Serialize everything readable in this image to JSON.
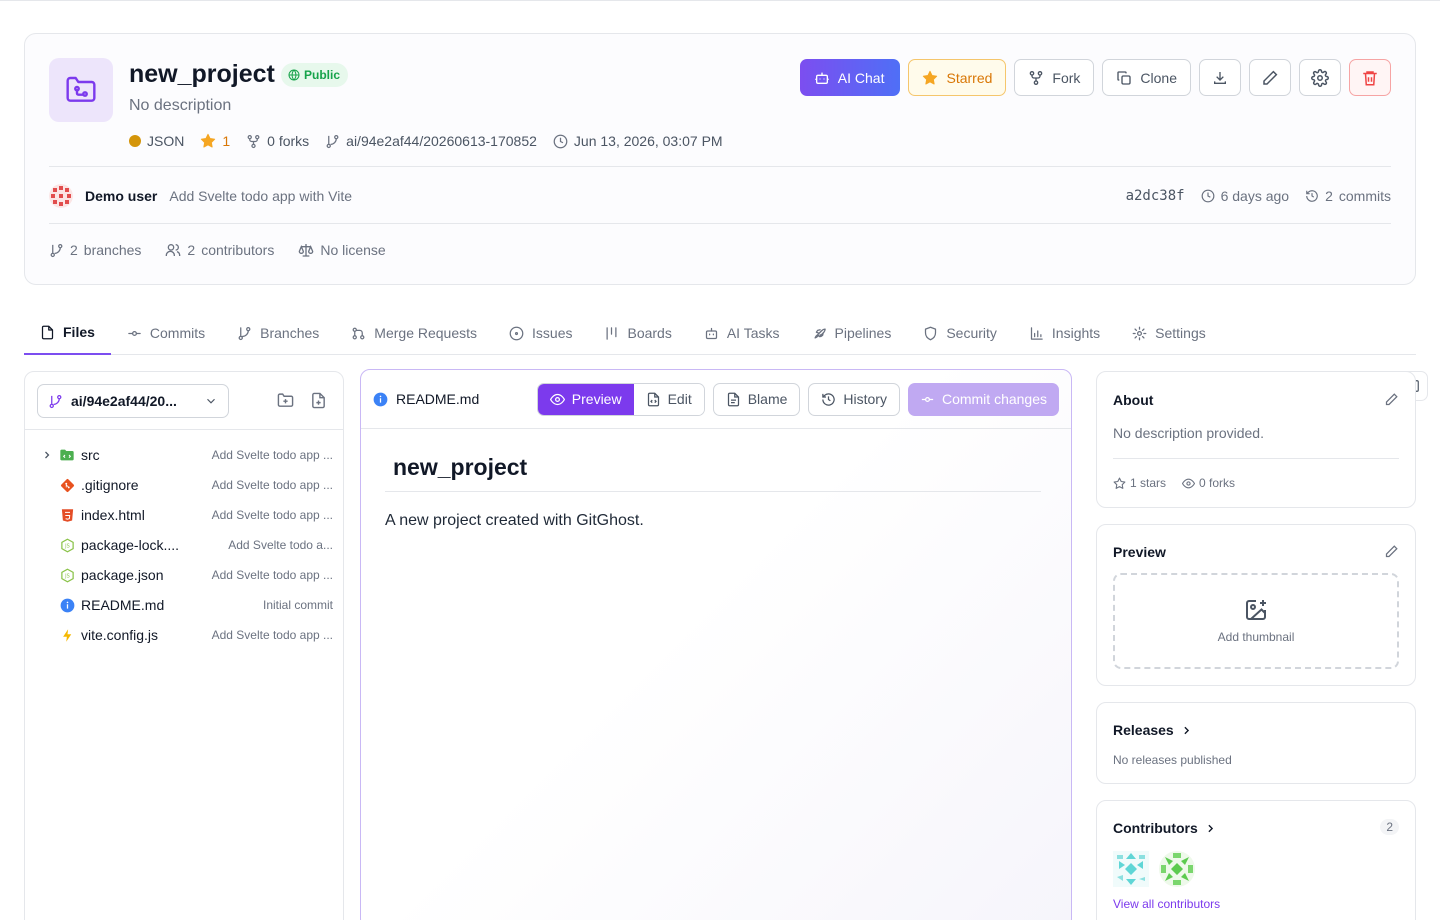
{
  "repo": {
    "name": "new_project",
    "visibility": "Public",
    "description": "No description",
    "language": "JSON",
    "language_color": "#d4950a",
    "stars": "1",
    "forks": "0 forks",
    "branch_ref": "ai/94e2af44/20260613-170852",
    "updated": "Jun 13, 2026, 03:07 PM"
  },
  "actions": {
    "ai_chat": "AI Chat",
    "starred": "Starred",
    "fork": "Fork",
    "clone": "Clone",
    "download_icon": "download-icon",
    "edit_icon": "pencil-icon",
    "settings_icon": "gear-icon",
    "delete_icon": "trash-icon"
  },
  "last_commit": {
    "author": "Demo user",
    "message": "Add Svelte todo app with Vite",
    "hash": "a2dc38f",
    "time": "6 days ago",
    "commits_count": "2",
    "commits_label": "commits"
  },
  "stats": {
    "branches_count": "2",
    "branches_label": "branches",
    "contributors_count": "2",
    "contributors_label": "contributors",
    "license": "No license"
  },
  "tabs": [
    {
      "label": "Files",
      "icon": "file-icon",
      "active": true
    },
    {
      "label": "Commits",
      "icon": "commit-icon"
    },
    {
      "label": "Branches",
      "icon": "branch-icon"
    },
    {
      "label": "Merge Requests",
      "icon": "merge-icon"
    },
    {
      "label": "Issues",
      "icon": "issue-icon"
    },
    {
      "label": "Boards",
      "icon": "boards-icon"
    },
    {
      "label": "AI Tasks",
      "icon": "robot-icon"
    },
    {
      "label": "Pipelines",
      "icon": "rocket-icon"
    },
    {
      "label": "Security",
      "icon": "shield-icon"
    },
    {
      "label": "Insights",
      "icon": "bar-chart-icon"
    },
    {
      "label": "Settings",
      "icon": "gear-icon"
    }
  ],
  "file_tree": {
    "branch": "ai/94e2af44/20...",
    "files": [
      {
        "name": "src",
        "message": "Add Svelte todo app ...",
        "icon": "folder-icon",
        "color": "#4caf50",
        "folder": true
      },
      {
        "name": ".gitignore",
        "message": "Add Svelte todo app ...",
        "icon": "git-icon",
        "color": "#e8521f"
      },
      {
        "name": "index.html",
        "message": "Add Svelte todo app ...",
        "icon": "html-icon",
        "color": "#e44d26"
      },
      {
        "name": "package-lock....",
        "message": "Add Svelte todo a...",
        "icon": "node-icon",
        "color": "#8bc34a"
      },
      {
        "name": "package.json",
        "message": "Add Svelte todo app ...",
        "icon": "node-icon",
        "color": "#8bc34a"
      },
      {
        "name": "README.md",
        "message": "Initial commit",
        "icon": "info-icon",
        "color": "#3b82f6"
      },
      {
        "name": "vite.config.js",
        "message": "Add Svelte todo app ...",
        "icon": "lightning-icon",
        "color": "#f5b800"
      }
    ]
  },
  "readme": {
    "filename": "README.md",
    "preview": "Preview",
    "edit": "Edit",
    "blame": "Blame",
    "history": "History",
    "commit_changes": "Commit changes",
    "heading": "new_project",
    "body": "A new project created with GitGhost."
  },
  "about": {
    "title": "About",
    "text": "No description provided.",
    "stars": "1 stars",
    "forks": "0 forks"
  },
  "preview_card": {
    "title": "Preview",
    "add_thumbnail": "Add thumbnail"
  },
  "releases": {
    "title": "Releases",
    "text": "No releases published"
  },
  "contributors": {
    "title": "Contributors",
    "count": "2",
    "view_all": "View all contributors"
  },
  "colors": {
    "accent": "#7c3aed",
    "starred": "#d97706",
    "public": "#16a34a"
  }
}
